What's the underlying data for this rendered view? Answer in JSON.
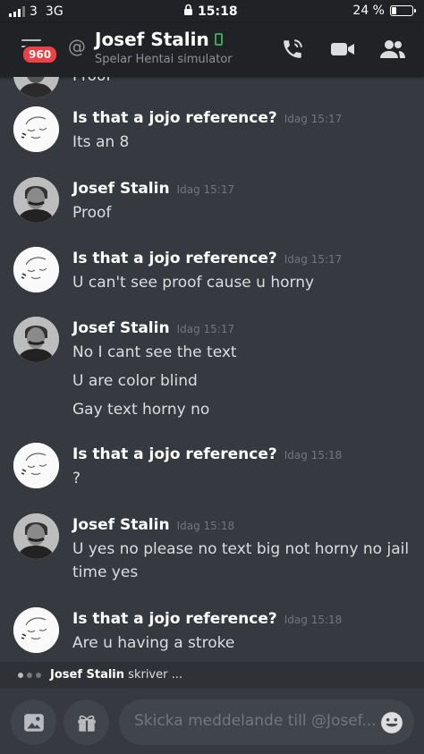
{
  "status_bar": {
    "carrier": "3",
    "network": "3G",
    "time": "15:18",
    "battery": "24 %",
    "battery_level_percent": 24
  },
  "header": {
    "unread_badge": "960",
    "at_symbol": "@",
    "title": "Josef Stalin",
    "subtitle": "Spelar Hentai simulator"
  },
  "partial_message": {
    "text": "Proof"
  },
  "messages": [
    {
      "author": "Is that a jojo reference?",
      "time": "Idag 15:17",
      "lines": [
        "Its an 8"
      ]
    },
    {
      "author": "Josef Stalin",
      "time": "Idag 15:17",
      "lines": [
        "Proof"
      ]
    },
    {
      "author": "Is that a jojo reference?",
      "time": "Idag 15:17",
      "lines": [
        "U can't see proof cause u horny"
      ]
    },
    {
      "author": "Josef Stalin",
      "time": "Idag 15:17",
      "lines": [
        "No I cant see the text",
        "U are color blind",
        "Gay text horny no"
      ]
    },
    {
      "author": "Is that a jojo reference?",
      "time": "Idag 15:18",
      "lines": [
        "?"
      ]
    },
    {
      "author": "Josef Stalin",
      "time": "Idag 15:18",
      "lines": [
        "U yes no please no text big not horny no jail time yes"
      ]
    },
    {
      "author": "Is that a jojo reference?",
      "time": "Idag 15:18",
      "lines": [
        "Are u having a stroke"
      ]
    }
  ],
  "typing": {
    "user": "Josef Stalin",
    "suffix": "skriver ..."
  },
  "composer": {
    "placeholder": "Skicka meddelande till @Josef..."
  },
  "colors": {
    "background": "#36393f",
    "header": "#202225",
    "badge": "#ed4245",
    "online_mobile": "#3ba55c"
  }
}
